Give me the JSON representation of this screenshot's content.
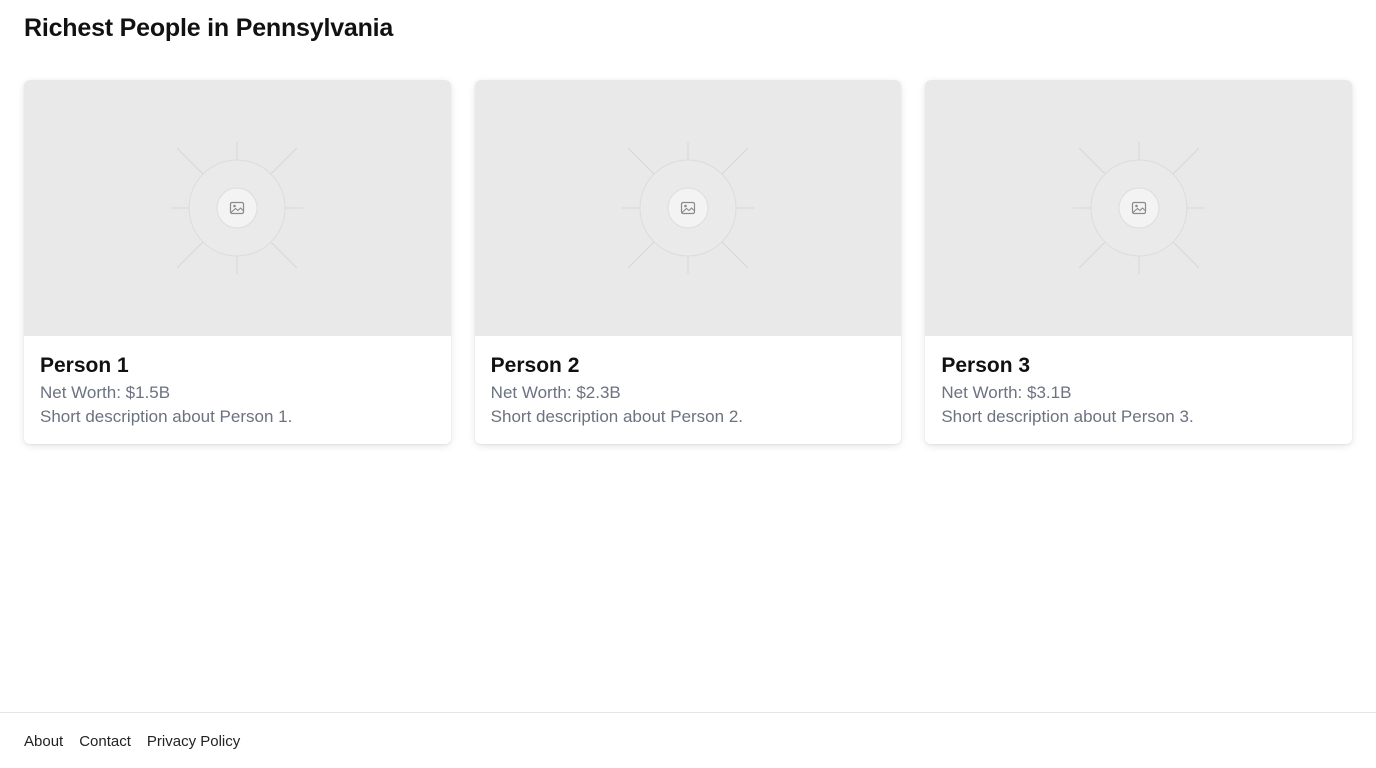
{
  "page": {
    "title": "Richest People in Pennsylvania"
  },
  "cards": [
    {
      "name": "Person 1",
      "net_worth": "Net Worth: $1.5B",
      "description": "Short description about Person 1.",
      "image_icon": "image-placeholder-icon"
    },
    {
      "name": "Person 2",
      "net_worth": "Net Worth: $2.3B",
      "description": "Short description about Person 2.",
      "image_icon": "image-placeholder-icon"
    },
    {
      "name": "Person 3",
      "net_worth": "Net Worth: $3.1B",
      "description": "Short description about Person 3.",
      "image_icon": "image-placeholder-icon"
    }
  ],
  "footer": {
    "links": [
      "About",
      "Contact",
      "Privacy Policy"
    ]
  },
  "colors": {
    "placeholder_bg": "#e9e9e9",
    "muted_text": "#6b7280",
    "footer_border": "#e5e5e5"
  }
}
